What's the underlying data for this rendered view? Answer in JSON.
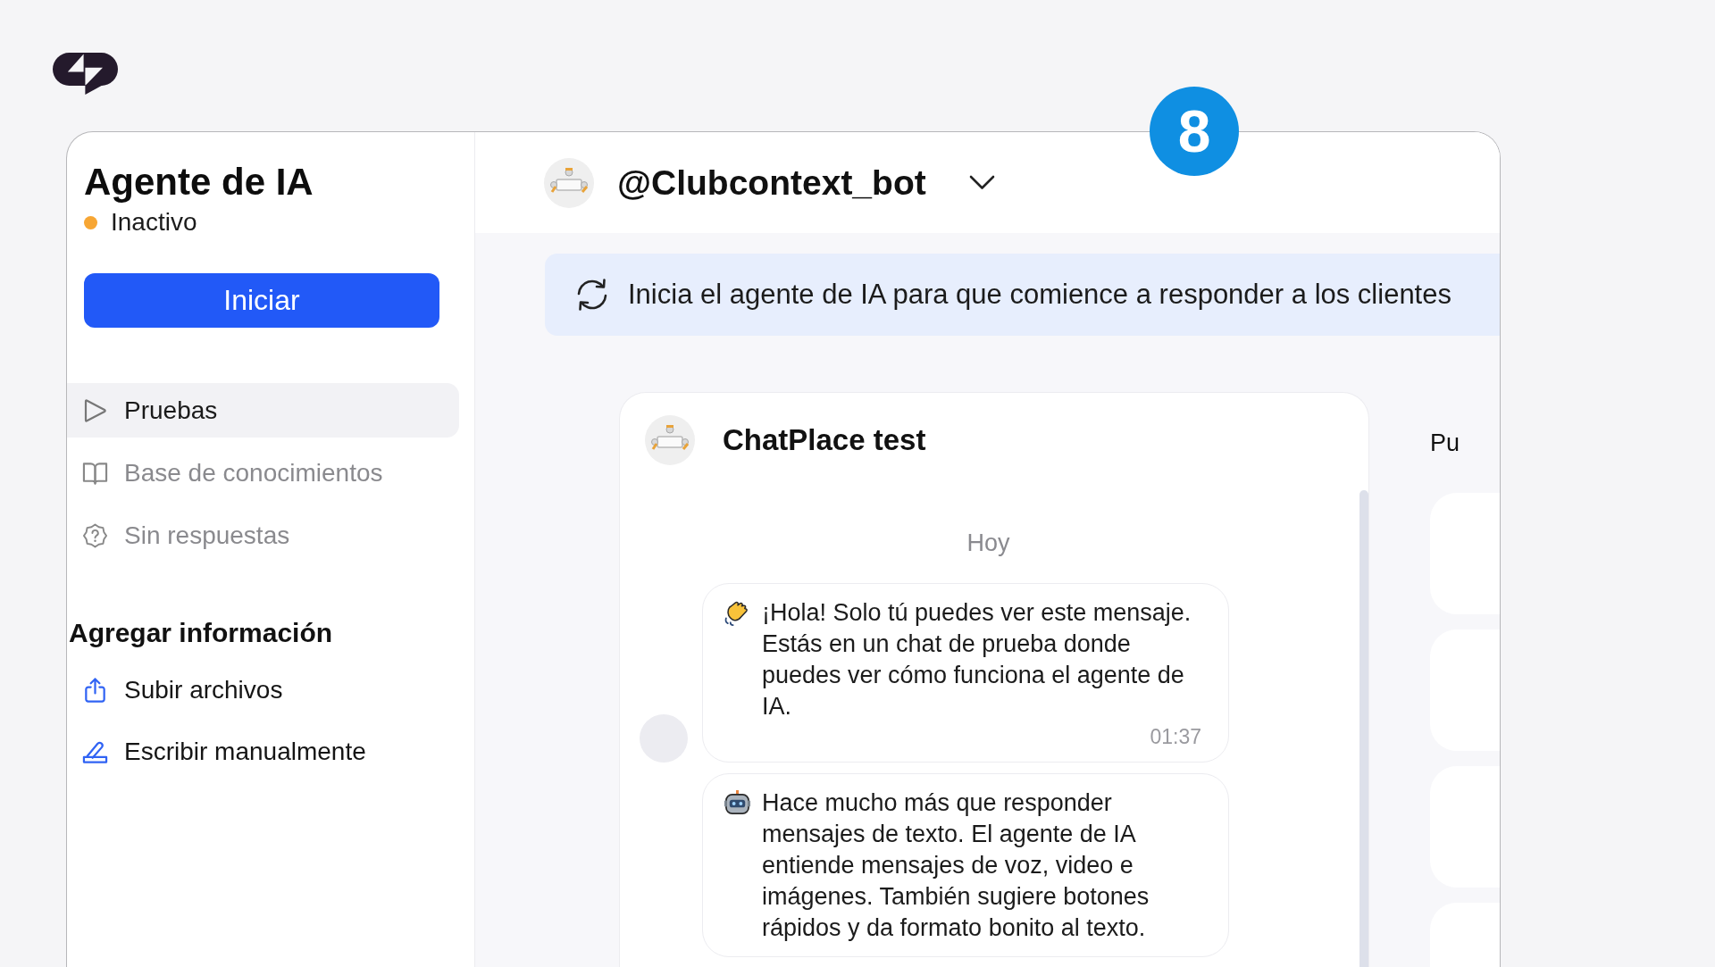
{
  "step_badge": "8",
  "sidebar": {
    "title": "Agente de IA",
    "status": {
      "label": "Inactivo",
      "active": false
    },
    "start_button": "Iniciar",
    "nav_items": [
      {
        "label": "Pruebas",
        "selected": true
      },
      {
        "label": "Base de conocimientos",
        "selected": false
      },
      {
        "label": "Sin respuestas",
        "selected": false
      }
    ],
    "add_section": {
      "title": "Agregar información",
      "items": [
        {
          "label": "Subir archivos"
        },
        {
          "label": "Escribir manualmente"
        }
      ]
    }
  },
  "header": {
    "bot_name": "@Clubcontext_bot"
  },
  "banner": {
    "text": "Inicia el agente de IA para que comience a responder a los clientes"
  },
  "chat": {
    "title": "ChatPlace test",
    "date": "Hoy",
    "messages": [
      {
        "text": "¡Hola! Solo tú puedes ver este mensaje. Estás en un chat de prueba donde puedes ver cómo funciona el agente de IA.",
        "time": "01:37",
        "avatar": true
      },
      {
        "text": "Hace mucho más que responder mensajes de texto. El agente de IA entiende mensajes de voz, video e imágenes. También sugiere botones rápidos y da formato bonito al texto.",
        "avatar": false
      }
    ]
  },
  "side_panel": {
    "heading": "Pu"
  }
}
